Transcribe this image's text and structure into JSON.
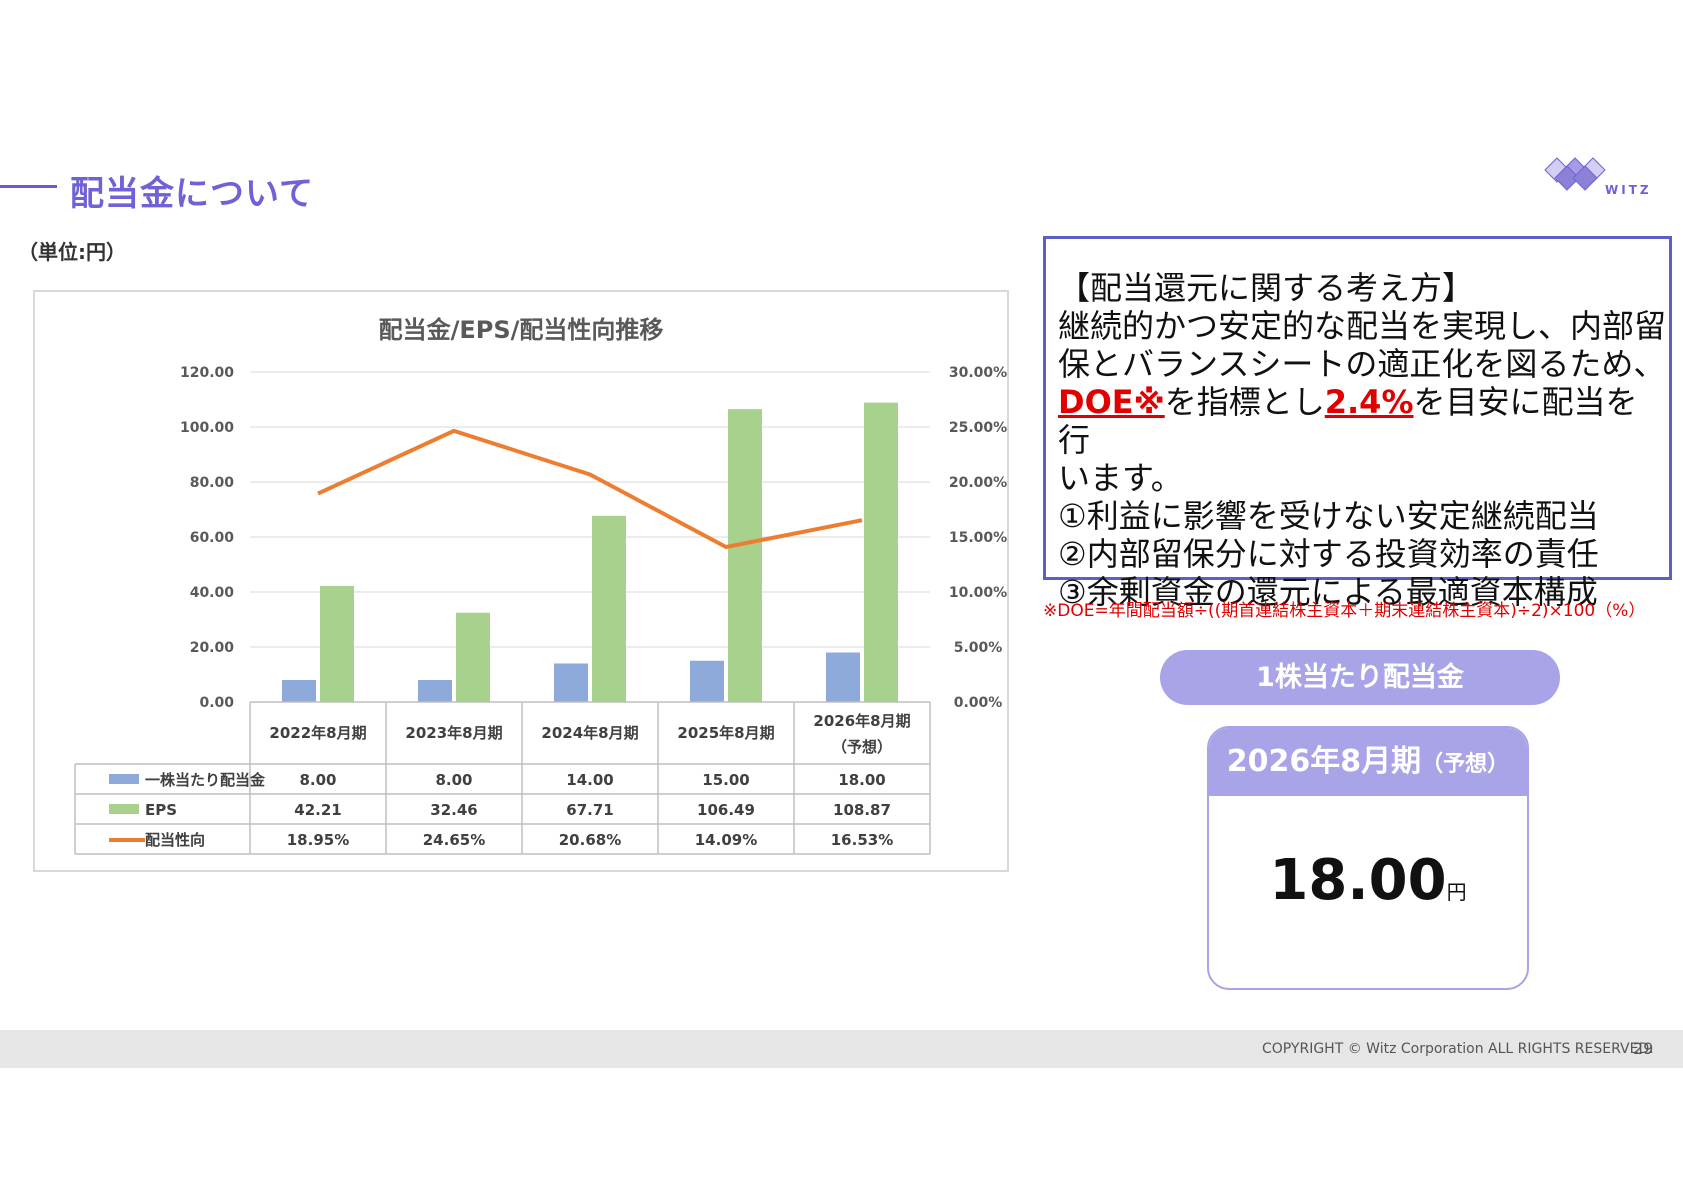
{
  "header": {
    "title": "配当金について",
    "unit_note": "（単位:円）",
    "logo_text": "WITZ"
  },
  "chart_data": {
    "type": "bar",
    "title": "配当金/EPS/配当性向推移",
    "categories": [
      "2022年8月期",
      "2023年8月期",
      "2024年8月期",
      "2025年8月期",
      "2026年8月期"
    ],
    "category_sublabels": [
      "",
      "",
      "",
      "",
      "（予想）"
    ],
    "series": [
      {
        "name": "一株当たり配当金",
        "kind": "bar",
        "axis": "left",
        "color": "#8eaadb",
        "values": [
          8.0,
          8.0,
          14.0,
          15.0,
          18.0
        ],
        "labels": [
          "8.00",
          "8.00",
          "14.00",
          "15.00",
          "18.00"
        ]
      },
      {
        "name": "EPS",
        "kind": "bar",
        "axis": "left",
        "color": "#a9d18e",
        "values": [
          42.21,
          32.46,
          67.71,
          106.49,
          108.87
        ],
        "labels": [
          "42.21",
          "32.46",
          "67.71",
          "106.49",
          "108.87"
        ]
      },
      {
        "name": "配当性向",
        "kind": "line",
        "axis": "right",
        "color": "#ed7d31",
        "values": [
          18.95,
          24.65,
          20.68,
          14.09,
          16.53
        ],
        "labels": [
          "18.95%",
          "24.65%",
          "20.68%",
          "14.09%",
          "16.53%"
        ]
      }
    ],
    "ylim_left": [
      0,
      120
    ],
    "yticks_left": [
      "0.00",
      "20.00",
      "40.00",
      "60.00",
      "80.00",
      "100.00",
      "120.00"
    ],
    "ylim_right": [
      0,
      30
    ],
    "yticks_right": [
      "0.00%",
      "5.00%",
      "10.00%",
      "15.00%",
      "20.00%",
      "25.00%",
      "30.00%"
    ],
    "grid": true,
    "legend": "data-table"
  },
  "policy": {
    "heading": "【配当還元に関する考え方】",
    "line1": "継続的かつ安定的な配当を実現し、内部留",
    "line2": "保とバランスシートの適正化を図るため、",
    "doe": "DOE※",
    "mid": "を指標とし",
    "pct": "2.4%",
    "tail": "を目安に配当を行",
    "line4": "います。",
    "p1": "①利益に影響を受けない安定継続配当",
    "p2": "②内部留保分に対する投資効率の責任",
    "p3": "③余剰資金の還元による最適資本構成"
  },
  "doe_note": "※DOE=年間配当額÷((期首連結株主資本＋期末連結株主資本)÷2)×100（%）",
  "highlight": {
    "pill_label": "1株当たり配当金",
    "period": "2026年8月期",
    "period_suffix": "（予想）",
    "value": "18.00",
    "unit": "円"
  },
  "footer": {
    "copyright": "COPYRIGHT © Witz Corporation ALL RIGHTS RESERVED.",
    "page": "29"
  },
  "colors": {
    "accent": "#6f62d6",
    "card": "#a9a3e8",
    "highlight_red": "#e00000"
  }
}
